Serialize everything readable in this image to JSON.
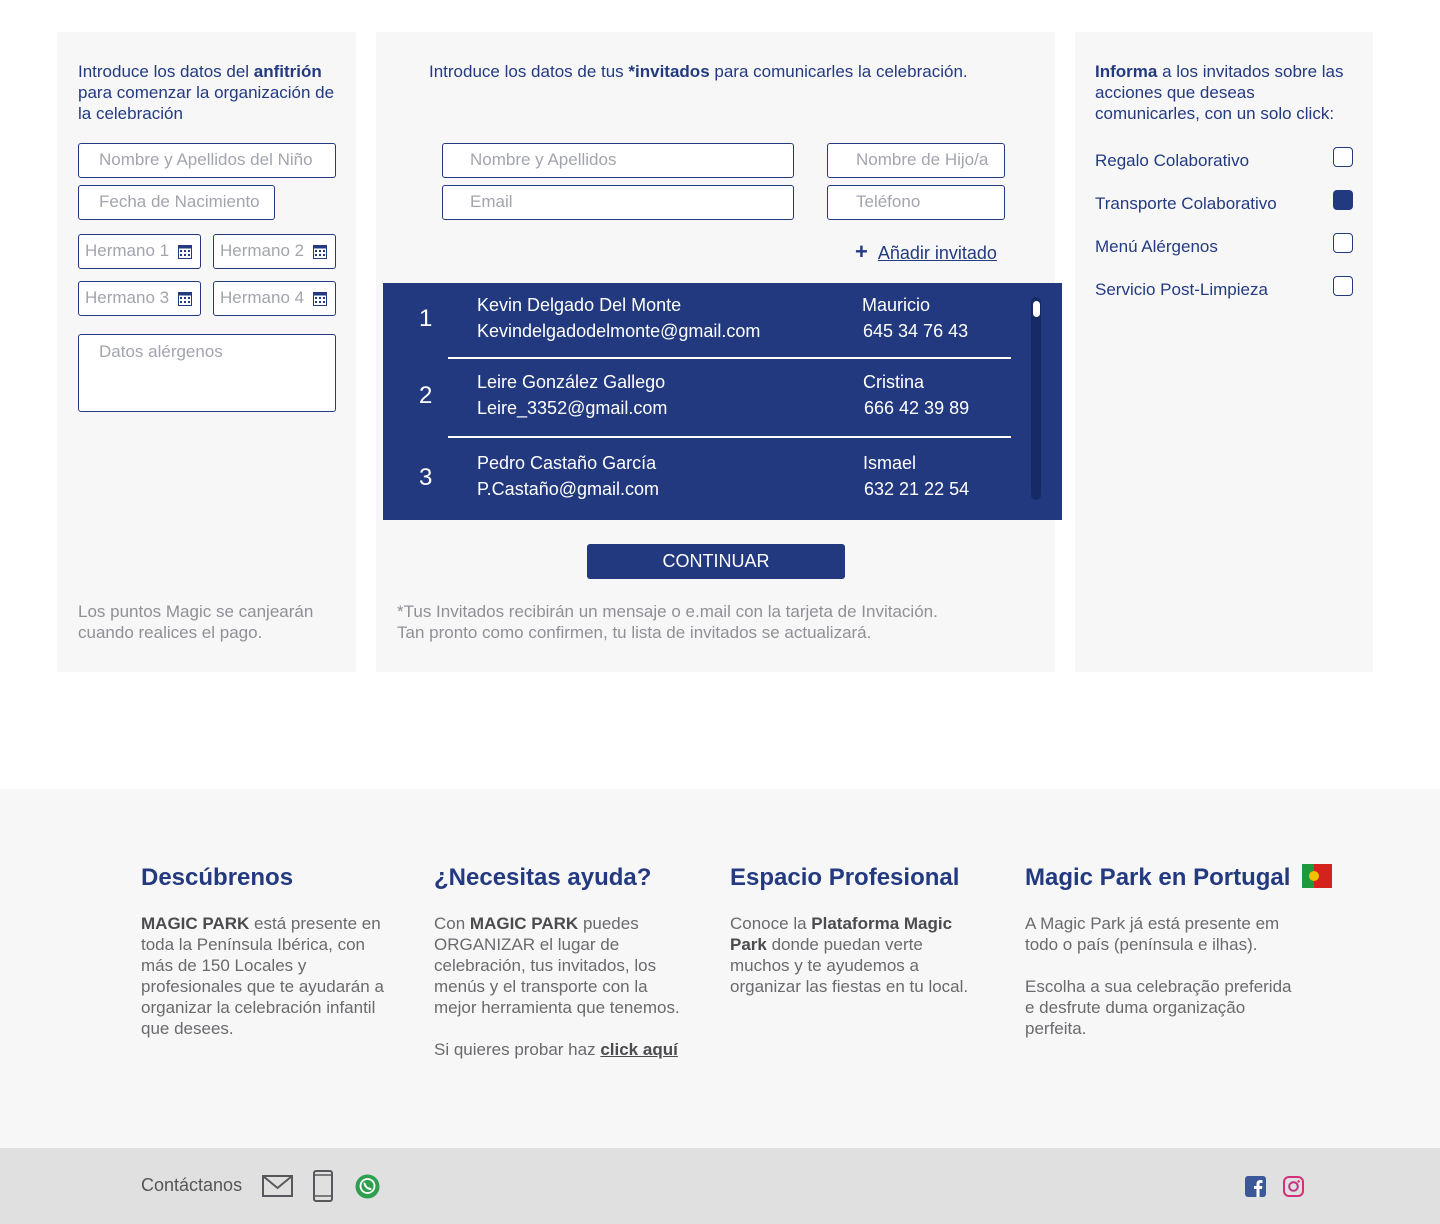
{
  "host": {
    "intro_a": "Introduce los datos del ",
    "intro_b": "anfitrión",
    "intro_c": " para comenzar la organización de la celebración",
    "child_name_placeholder": "Nombre y Apellidos del Niño",
    "birth_placeholder": "Fecha de Nacimiento",
    "siblings": [
      "Hermano 1",
      "Hermano 2",
      "Hermano 3",
      "Hermano 4"
    ],
    "allergens_placeholder": "Datos alérgenos",
    "note": "Los puntos Magic se canjearán cuando realices el pago."
  },
  "guests": {
    "intro_a": "Introduce los datos de tus ",
    "intro_b": "*invitados",
    "intro_c": " para comunicarles la celebración.",
    "name_placeholder": "Nombre y Apellidos",
    "child_placeholder": "Nombre de Hijo/a",
    "email_placeholder": "Email",
    "phone_placeholder": "Teléfono",
    "add_plus": "+",
    "add_label": "Añadir invitado",
    "list": [
      {
        "num": "1",
        "name": "Kevin Delgado Del Monte",
        "email": "Kevindelgadodelmonte@gmail.com",
        "child": "Mauricio",
        "phone": "645 34 76 43"
      },
      {
        "num": "2",
        "name": "Leire González Gallego",
        "email": "Leire_3352@gmail.com",
        "child": "Cristina",
        "phone": "666 42 39 89"
      },
      {
        "num": "3",
        "name": "Pedro Castaño García",
        "email": "P.Castaño@gmail.com",
        "child": "Ismael",
        "phone": "632 21 22 54"
      }
    ],
    "continue_label": "CONTINUAR",
    "note_line1": "*Tus Invitados recibirán un mensaje o e.mail con la tarjeta de Invitación.",
    "note_line2": "Tan pronto como confirmen, tu lista de invitados se actualizará."
  },
  "actions": {
    "intro_a": "Informa",
    "intro_b": " a los invitados sobre las acciones que deseas comunicarles, con un solo click:",
    "options": [
      {
        "label": "Regalo Colaborativo",
        "checked": false
      },
      {
        "label": "Transporte Colaborativo",
        "checked": true
      },
      {
        "label": "Menú Alérgenos",
        "checked": false
      },
      {
        "label": "Servicio Post-Limpieza",
        "checked": false
      }
    ]
  },
  "footer": {
    "discover": {
      "title": "Descúbrenos",
      "brand": "MAGIC PARK",
      "text": " está presente en toda la Península Ibérica, con más de 150 Locales y profesionales que te ayudarán a organizar la celebración infantil que desees."
    },
    "help": {
      "title": "¿Necesitas ayuda?",
      "pre": "Con ",
      "brand": "MAGIC PARK",
      "text": " puedes ORGANIZAR el lugar de celebración, tus invitados, los menús y el transporte con la mejor herramienta que tenemos.",
      "try_text": "Si quieres probar haz ",
      "try_link": "click aquí"
    },
    "pro": {
      "title": "Espacio Profesional",
      "pre": "Conoce la ",
      "brand": "Plataforma Magic Park",
      "text": " donde puedan verte muchos y te ayudemos a organizar las fiestas en tu local."
    },
    "portugal": {
      "title": "Magic Park en Portugal",
      "p1": "A Magic Park já está presente em todo o país (península e ilhas).",
      "p2": "Escolha a sua celebração preferida e desfrute duma organização perfeita."
    },
    "contact_label": "Contáctanos",
    "contact_icons": [
      "mail-icon",
      "phone-icon",
      "whatsapp-icon"
    ],
    "social_icons": [
      "facebook-icon",
      "instagram-icon"
    ]
  },
  "colors": {
    "brand": "#233a80",
    "panel": "#f7f7f8",
    "list_bg": "#22397f",
    "footer_bar": "#e0e0e1"
  }
}
